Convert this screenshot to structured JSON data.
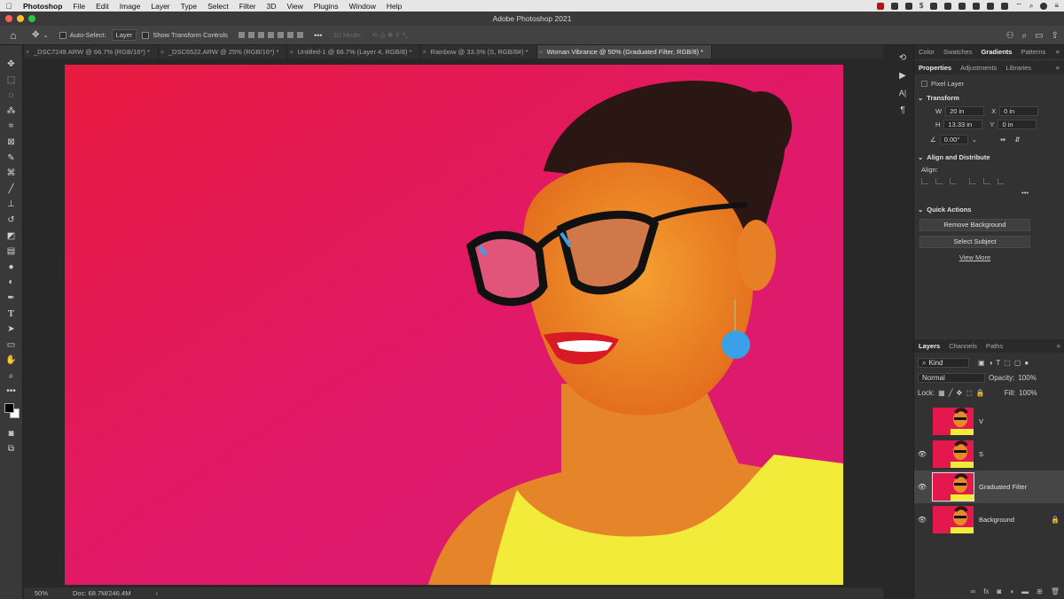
{
  "menubar": {
    "apple_icon": "apple-icon",
    "items": [
      "Photoshop",
      "File",
      "Edit",
      "Image",
      "Layer",
      "Type",
      "Select",
      "Filter",
      "3D",
      "View",
      "Plugins",
      "Window",
      "Help"
    ]
  },
  "titlebar": {
    "title": "Adobe Photoshop 2021"
  },
  "options": {
    "auto_select_label": "Auto-Select:",
    "auto_select_value": "Layer",
    "transform_label": "Show Transform Controls",
    "more": "•••",
    "mode_3d": "3D Mode:"
  },
  "tabs": [
    "_DSC7249.ARW @ 66.7% (RGB/16*) *",
    "_DSC6522.ARW @ 25% (RGB/16*) *",
    "Untitled-1 @ 66.7% (Layer 4, RGB/8) *",
    "Rainbow @ 33.3% (S, RGB/8#) *",
    "Woman Vibrance @ 50% (Graduated Filter, RGB/8) *"
  ],
  "tab_close": "×",
  "status": {
    "zoom": "50%",
    "doc": "Doc: 68.7M/246.4M",
    "arrow": "›"
  },
  "panels": {
    "top_tabs": [
      "Color",
      "Swatches",
      "Gradients",
      "Patterns"
    ],
    "prop_tabs": [
      "Properties",
      "Adjustments",
      "Libraries"
    ],
    "pixel_layer": "Pixel Layer",
    "transform": {
      "title": "Transform",
      "w_label": "W",
      "w": "20 in",
      "x_label": "X",
      "x": "0 in",
      "h_label": "H",
      "h": "13.33 in",
      "y_label": "Y",
      "y": "0 in",
      "angle": "0.00°"
    },
    "align": {
      "title": "Align and Distribute",
      "label": "Align:"
    },
    "quick": {
      "title": "Quick Actions",
      "remove_bg": "Remove Background",
      "select_subject": "Select Subject",
      "view_more": "View More"
    },
    "more": "•••",
    "menu": "≡"
  },
  "layers_panel": {
    "tabs": [
      "Layers",
      "Channels",
      "Paths"
    ],
    "kind": "Kind",
    "blend": "Normal",
    "opacity_label": "Opacity:",
    "opacity": "100%",
    "lock_label": "Lock:",
    "fill_label": "Fill:",
    "fill": "100%",
    "layers": [
      {
        "name": "V",
        "visible": false
      },
      {
        "name": "S",
        "visible": true
      },
      {
        "name": "Graduated Filter",
        "visible": true,
        "selected": true
      },
      {
        "name": "Background",
        "visible": true,
        "locked": true
      }
    ],
    "footer": [
      "link-icon",
      "fx",
      "mask-icon",
      "adjustment-icon",
      "group-icon",
      "new-layer-icon",
      "trash-icon"
    ]
  },
  "colors": {
    "accent_bg": "#e4194e",
    "top_yellow": "#f2eb3a",
    "lens_blue": "#3aa0e8"
  }
}
